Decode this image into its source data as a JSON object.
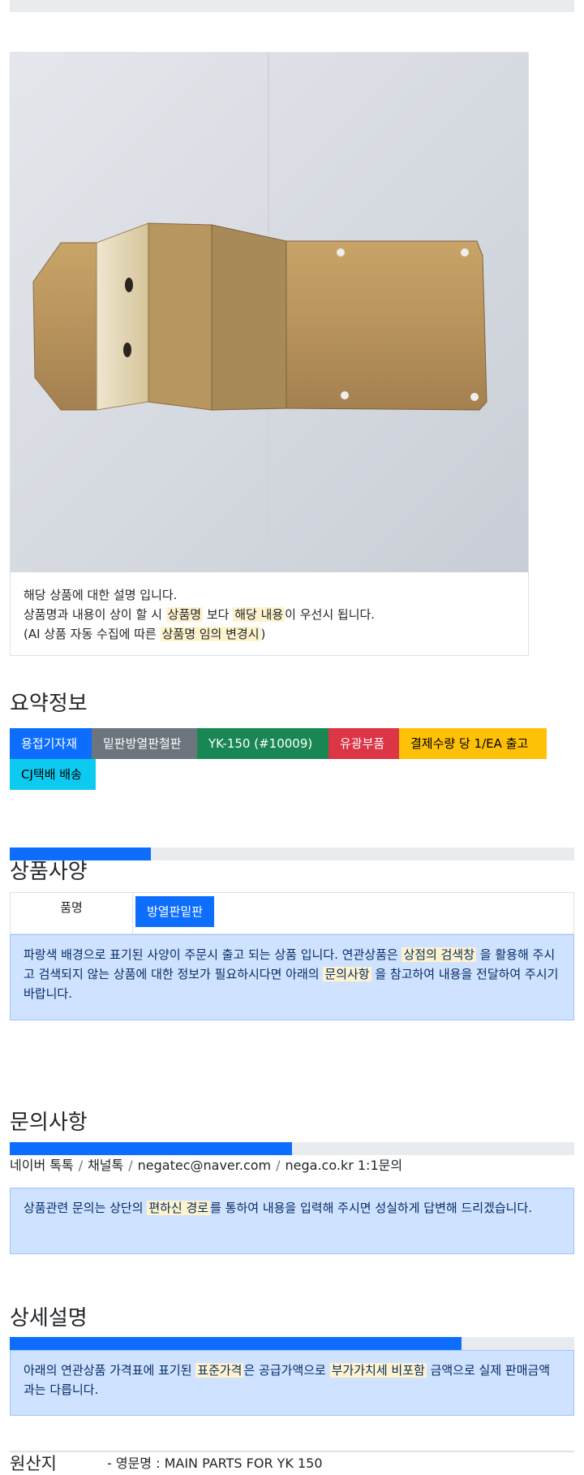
{
  "product": {
    "photo_alt": "bracket-photo",
    "notice_line1": "해당 상품에 대한 설명 입니다.",
    "notice_line2_a": "상품명과 내용이 상이 할 시 ",
    "notice_line2_hl1": "상품명",
    "notice_line2_b": " 보다 ",
    "notice_line2_hl2": "해당 내용",
    "notice_line2_c": "이 우선시 됩니다.",
    "notice_line3_a": "(AI 상품 자동 수집에 따른 ",
    "notice_line3_hl": "상품명 임의 변경시",
    "notice_line3_b": ")"
  },
  "summary": {
    "title": "요약정보",
    "badges": [
      {
        "label": "용접기자재",
        "color": "#0d6efd",
        "text_color": "#ffffff"
      },
      {
        "label": "밑판방열판철판",
        "color": "#6c757d",
        "text_color": "#ffffff"
      },
      {
        "label": "YK-150 (#10009)",
        "color": "#198754",
        "text_color": "#ffffff"
      },
      {
        "label": "유광부품",
        "color": "#dc3545",
        "text_color": "#ffffff"
      },
      {
        "label": "결제수량 당 1/EA 출고",
        "color": "#ffc107",
        "text_color": "#000000"
      },
      {
        "label": "CJ택배 배송",
        "color": "#0dcaf0",
        "text_color": "#000000"
      }
    ]
  },
  "spec": {
    "title": "상품사양",
    "progress": 0.25,
    "name_label": "품명",
    "name_value": "방열판밑판",
    "alert_a": "파랑색 배경으로 표기된 사양이 주문시 출고 되는 상품 입니다. 연관상품은 ",
    "alert_hl1": "상점의 검색창",
    "alert_b": " 을 활용해 주시고 검색되지 않는 상품에 대한 정보가 필요하시다면 아래의 ",
    "alert_hl2": "문의사항",
    "alert_c": " 을 참고하여 내용을 전달하여 주시기 바랍니다."
  },
  "inquiry": {
    "title": "문의사항",
    "progress": 0.5,
    "contacts": [
      "네이버 톡톡",
      "채널톡",
      "negatec@naver.com",
      "nega.co.kr 1:1문의"
    ],
    "separator": "/",
    "alert_a": "상품관련 문의는 상단의 ",
    "alert_hl": "편하신 경로",
    "alert_b": "를 통하여 내용을 입력해 주시면 성실하게 답변해 드리겠습니다."
  },
  "detail": {
    "title": "상세설명",
    "progress": 0.8,
    "alert_a": "아래의 연관상품 가격표에 표기된 ",
    "alert_hl1": "표준가격",
    "alert_b": "은 공급가액으로 ",
    "alert_hl2": "부가가치세 비포함",
    "alert_c": " 금액으로 실제 판매금액과는 다릅니다."
  },
  "origin": {
    "label": "원산지",
    "value": "- 영문명 : MAIN PARTS FOR YK 150"
  },
  "colors": {
    "primary": "#0d6efd",
    "alert_bg": "#cfe2ff",
    "highlight": "#fff3cd"
  }
}
